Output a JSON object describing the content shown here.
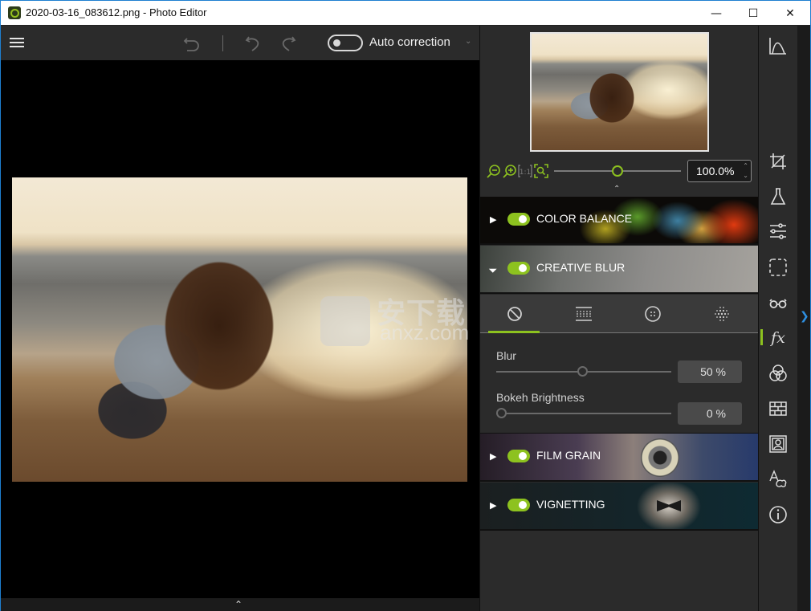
{
  "window": {
    "title": "2020-03-16_083612.png - Photo Editor",
    "controls": {
      "minimize": "—",
      "maximize": "☐",
      "close": "✕"
    }
  },
  "toolbar": {
    "menu_icon": "hamburger-icon",
    "undo_all_icon": "undo-all-icon",
    "undo_icon": "undo-icon",
    "redo_icon": "redo-icon",
    "auto_correction": {
      "label": "Auto correction",
      "enabled": false
    },
    "dropdown_icon": "chevron-down-icon"
  },
  "canvas": {
    "watermark_text": "安下载",
    "watermark_sub": "anxz.com"
  },
  "navigator": {
    "zoom_value": "100.0%",
    "zoom_slider_fraction": 0.5,
    "icons": [
      "zoom-out-icon",
      "zoom-in-icon",
      "actual-size-icon",
      "fit-to-screen-icon"
    ]
  },
  "effects": [
    {
      "id": "color-balance",
      "label": "COLOR BALANCE",
      "enabled": true,
      "expanded": false
    },
    {
      "id": "creative-blur",
      "label": "CREATIVE BLUR",
      "enabled": true,
      "expanded": true
    },
    {
      "id": "film-grain",
      "label": "FILM GRAIN",
      "enabled": true,
      "expanded": false
    },
    {
      "id": "vignetting",
      "label": "VIGNETTING",
      "enabled": true,
      "expanded": false
    }
  ],
  "creative_blur": {
    "modes": [
      "none",
      "linear",
      "radial",
      "custom"
    ],
    "active_mode": 0,
    "params": [
      {
        "label": "Blur",
        "value": "50 %",
        "fraction": 0.5
      },
      {
        "label": "Bokeh Brightness",
        "value": "0 %",
        "fraction": 0.0
      }
    ]
  },
  "rail": {
    "items": [
      "histogram",
      "crop",
      "flask",
      "adjustments",
      "selection",
      "glasses",
      "fx",
      "color-circles",
      "texture-brick",
      "portrait-frame",
      "text-effects",
      "info"
    ],
    "active": "fx",
    "fx_label": "fx"
  },
  "colors": {
    "accent": "#8dc21f",
    "panel": "#2b2b2b",
    "canvas": "#000000",
    "border": "#1e7fd0"
  }
}
